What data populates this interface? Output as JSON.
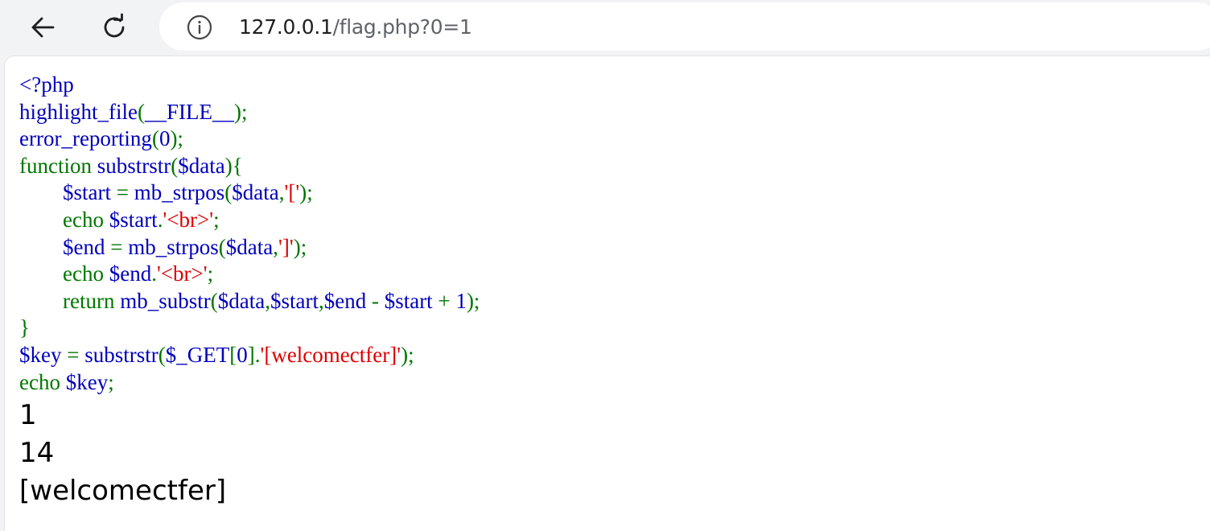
{
  "browser": {
    "url_host": "127.0.0.1",
    "url_path": "/flag.php?0=1",
    "icons": {
      "back": "back-arrow-icon",
      "reload": "reload-icon",
      "info": "info-icon"
    }
  },
  "colors": {
    "default": "#0000bb",
    "keyword": "#007700",
    "string": "#dd0000"
  },
  "code_lines": [
    [
      {
        "t": "<?php",
        "c": "default"
      }
    ],
    [
      {
        "t": "highlight_file",
        "c": "default"
      },
      {
        "t": "(",
        "c": "keyword"
      },
      {
        "t": "__FILE__",
        "c": "default"
      },
      {
        "t": ");",
        "c": "keyword"
      }
    ],
    [
      {
        "t": "error_reporting",
        "c": "default"
      },
      {
        "t": "(",
        "c": "keyword"
      },
      {
        "t": "0",
        "c": "default"
      },
      {
        "t": ");",
        "c": "keyword"
      }
    ],
    [
      {
        "t": "function ",
        "c": "keyword"
      },
      {
        "t": "substrstr",
        "c": "default"
      },
      {
        "t": "(",
        "c": "keyword"
      },
      {
        "t": "$data",
        "c": "default"
      },
      {
        "t": "){",
        "c": "keyword"
      }
    ],
    [
      {
        "t": "        ",
        "c": "default"
      },
      {
        "t": "$start ",
        "c": "default"
      },
      {
        "t": "= ",
        "c": "keyword"
      },
      {
        "t": "mb_strpos",
        "c": "default"
      },
      {
        "t": "(",
        "c": "keyword"
      },
      {
        "t": "$data",
        "c": "default"
      },
      {
        "t": ",",
        "c": "keyword"
      },
      {
        "t": "'['",
        "c": "string"
      },
      {
        "t": ");",
        "c": "keyword"
      }
    ],
    [
      {
        "t": "        ",
        "c": "default"
      },
      {
        "t": "echo ",
        "c": "keyword"
      },
      {
        "t": "$start",
        "c": "default"
      },
      {
        "t": ".",
        "c": "keyword"
      },
      {
        "t": "'<br>'",
        "c": "string"
      },
      {
        "t": ";",
        "c": "keyword"
      }
    ],
    [
      {
        "t": "        ",
        "c": "default"
      },
      {
        "t": "$end ",
        "c": "default"
      },
      {
        "t": "= ",
        "c": "keyword"
      },
      {
        "t": "mb_strpos",
        "c": "default"
      },
      {
        "t": "(",
        "c": "keyword"
      },
      {
        "t": "$data",
        "c": "default"
      },
      {
        "t": ",",
        "c": "keyword"
      },
      {
        "t": "']'",
        "c": "string"
      },
      {
        "t": ");",
        "c": "keyword"
      }
    ],
    [
      {
        "t": "        ",
        "c": "default"
      },
      {
        "t": "echo ",
        "c": "keyword"
      },
      {
        "t": "$end",
        "c": "default"
      },
      {
        "t": ".",
        "c": "keyword"
      },
      {
        "t": "'<br>'",
        "c": "string"
      },
      {
        "t": ";",
        "c": "keyword"
      }
    ],
    [
      {
        "t": "        ",
        "c": "default"
      },
      {
        "t": "return ",
        "c": "keyword"
      },
      {
        "t": "mb_substr",
        "c": "default"
      },
      {
        "t": "(",
        "c": "keyword"
      },
      {
        "t": "$data",
        "c": "default"
      },
      {
        "t": ",",
        "c": "keyword"
      },
      {
        "t": "$start",
        "c": "default"
      },
      {
        "t": ",",
        "c": "keyword"
      },
      {
        "t": "$end ",
        "c": "default"
      },
      {
        "t": "- ",
        "c": "keyword"
      },
      {
        "t": "$start ",
        "c": "default"
      },
      {
        "t": "+ ",
        "c": "keyword"
      },
      {
        "t": "1",
        "c": "default"
      },
      {
        "t": ");",
        "c": "keyword"
      }
    ],
    [
      {
        "t": "}",
        "c": "keyword"
      }
    ],
    [
      {
        "t": "$key ",
        "c": "default"
      },
      {
        "t": "= ",
        "c": "keyword"
      },
      {
        "t": "substrstr",
        "c": "default"
      },
      {
        "t": "(",
        "c": "keyword"
      },
      {
        "t": "$_GET",
        "c": "default"
      },
      {
        "t": "[",
        "c": "keyword"
      },
      {
        "t": "0",
        "c": "default"
      },
      {
        "t": "].",
        "c": "keyword"
      },
      {
        "t": "'[welcomectfer]'",
        "c": "string"
      },
      {
        "t": ");",
        "c": "keyword"
      }
    ],
    [
      {
        "t": "echo ",
        "c": "keyword"
      },
      {
        "t": "$key",
        "c": "default"
      },
      {
        "t": ";",
        "c": "keyword"
      }
    ]
  ],
  "output": {
    "lines": [
      "1",
      "14",
      "[welcomectfer]"
    ]
  }
}
